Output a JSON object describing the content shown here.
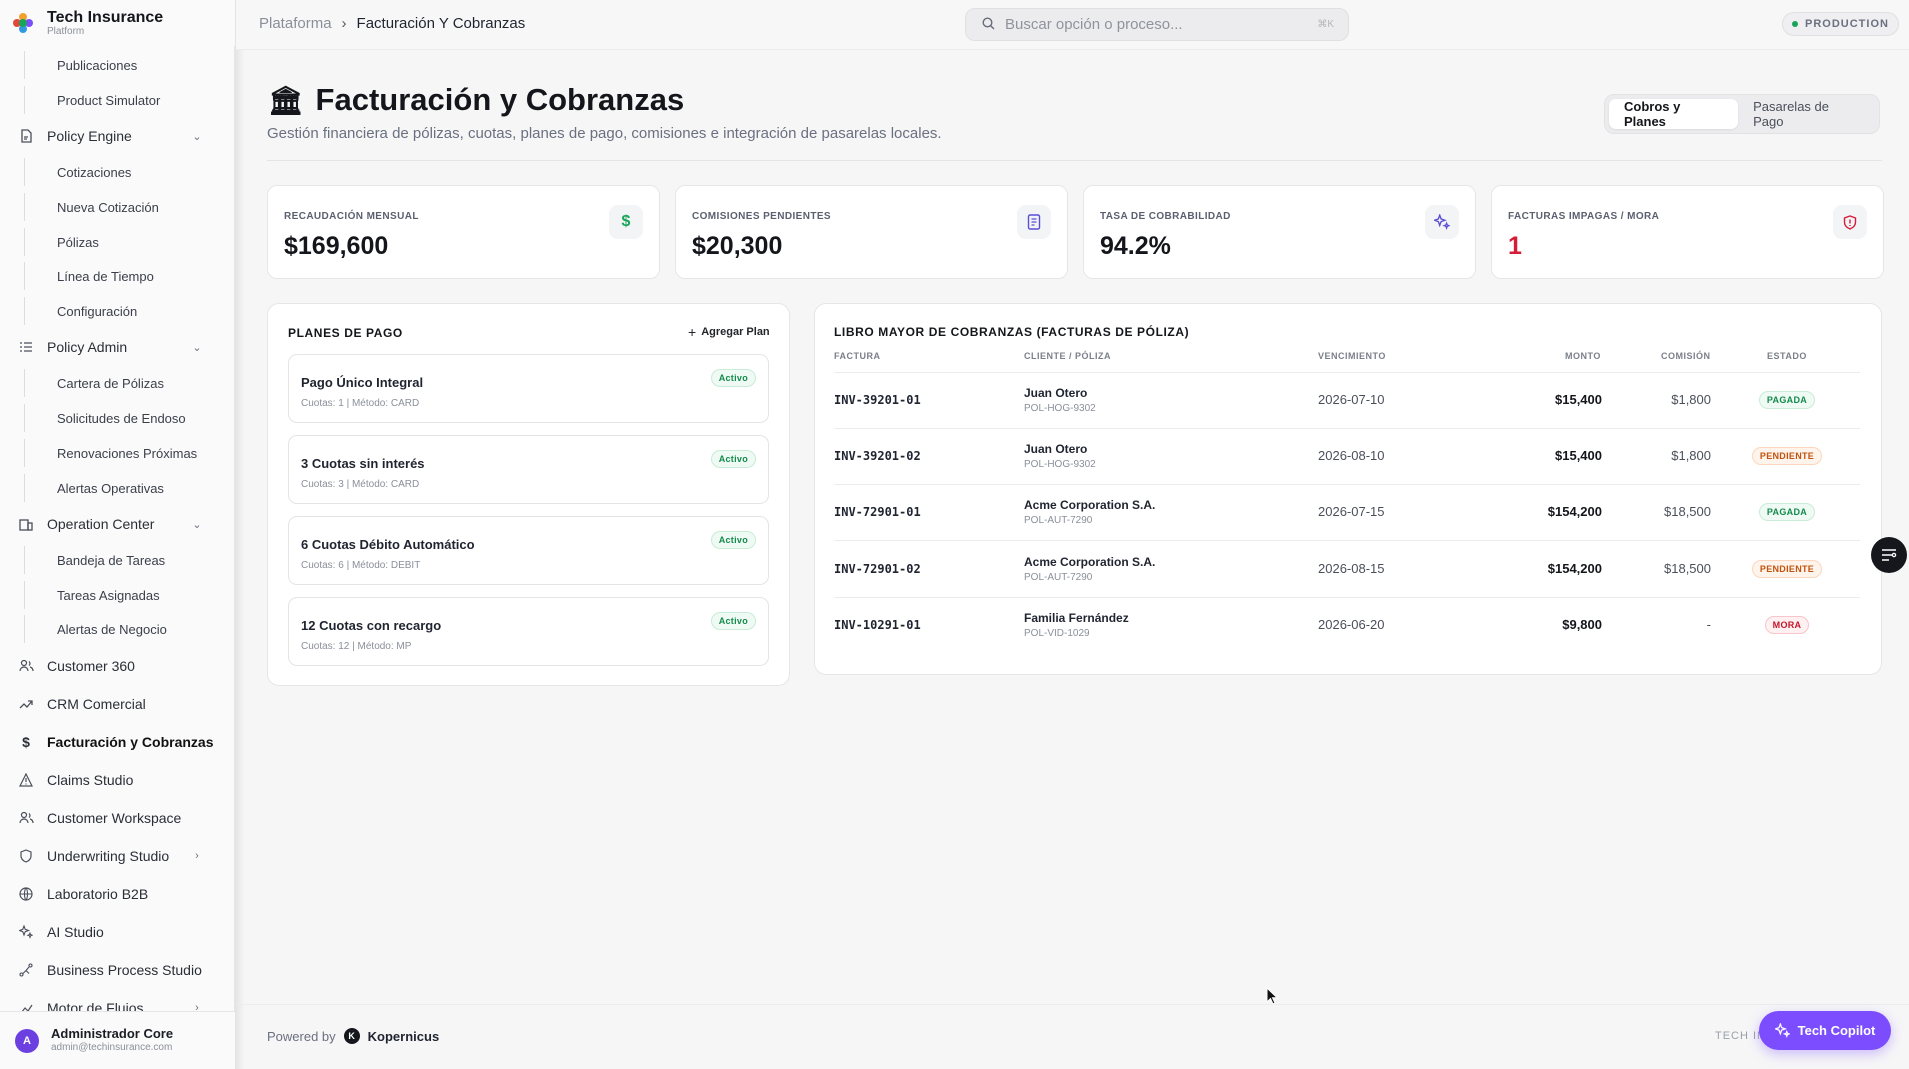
{
  "brand": {
    "name": "Tech Insurance",
    "sub": "Platform"
  },
  "sidebar": {
    "items": [
      {
        "label": "Publicaciones",
        "type": "sub"
      },
      {
        "label": "Product Simulator",
        "type": "sub"
      },
      {
        "label": "Policy Engine",
        "type": "group",
        "icon": "document-icon"
      },
      {
        "label": "Cotizaciones",
        "type": "sub"
      },
      {
        "label": "Nueva Cotización",
        "type": "sub"
      },
      {
        "label": "Pólizas",
        "type": "sub"
      },
      {
        "label": "Línea de Tiempo",
        "type": "sub"
      },
      {
        "label": "Configuración",
        "type": "sub"
      },
      {
        "label": "Policy Admin",
        "type": "group",
        "icon": "list-icon"
      },
      {
        "label": "Cartera de Pólizas",
        "type": "sub"
      },
      {
        "label": "Solicitudes de Endoso",
        "type": "sub"
      },
      {
        "label": "Renovaciones Próximas",
        "type": "sub"
      },
      {
        "label": "Alertas Operativas",
        "type": "sub"
      },
      {
        "label": "Operation Center",
        "type": "group",
        "icon": "building-icon"
      },
      {
        "label": "Bandeja de Tareas",
        "type": "sub"
      },
      {
        "label": "Tareas Asignadas",
        "type": "sub"
      },
      {
        "label": "Alertas de Negocio",
        "type": "sub"
      },
      {
        "label": "Customer 360",
        "type": "item",
        "icon": "users-icon"
      },
      {
        "label": "CRM Comercial",
        "type": "item",
        "icon": "trend-icon"
      },
      {
        "label": "Facturación y Cobranzas",
        "type": "item",
        "icon": "dollar-icon",
        "active": true
      },
      {
        "label": "Claims Studio",
        "type": "item",
        "icon": "warning-icon"
      },
      {
        "label": "Customer Workspace",
        "type": "item",
        "icon": "users-icon"
      },
      {
        "label": "Underwriting Studio",
        "type": "item",
        "icon": "shield-icon",
        "chevron": true
      },
      {
        "label": "Laboratorio B2B",
        "type": "item",
        "icon": "globe-icon"
      },
      {
        "label": "AI Studio",
        "type": "item",
        "icon": "sparkle-icon"
      },
      {
        "label": "Business Process Studio",
        "type": "item",
        "icon": "flow-icon"
      },
      {
        "label": "Motor de Flujos",
        "type": "item",
        "icon": "flow-icon",
        "chevron": true
      }
    ]
  },
  "user": {
    "initial": "A",
    "name": "Administrador Core",
    "email": "admin@techinsurance.com"
  },
  "topbar": {
    "breadcrumb_root": "Plataforma",
    "breadcrumb_current": "Facturación Y Cobranzas",
    "search_placeholder": "Buscar opción o proceso...",
    "shortcut": "⌘K",
    "env": "PRODUCTION"
  },
  "header": {
    "title": "Facturación y Cobranzas",
    "subtitle": "Gestión financiera de pólizas, cuotas, planes de pago, comisiones e integración de pasarelas locales.",
    "tabs": [
      "Cobros y Planes",
      "Pasarelas de Pago"
    ]
  },
  "kpis": [
    {
      "label": "RECAUDACIÓN MENSUAL",
      "value": "$169,600",
      "icon": "dollar-icon",
      "icon_color": "#18a558"
    },
    {
      "label": "COMISIONES PENDIENTES",
      "value": "$20,300",
      "icon": "receipt-icon",
      "icon_color": "#5b4fd6"
    },
    {
      "label": "TASA DE COBRABILIDAD",
      "value": "94.2%",
      "icon": "sparkle-icon",
      "icon_color": "#5b4fd6"
    },
    {
      "label": "FACTURAS IMPAGAS / MORA",
      "value": "1",
      "icon": "shield-alert-icon",
      "icon_color": "#d41d3a",
      "value_color": "#d41d3a"
    }
  ],
  "plans": {
    "title": "PLANES DE PAGO",
    "add_label": "Agregar Plan",
    "items": [
      {
        "name": "Pago Único Integral",
        "meta": "Cuotas: 1 | Método: CARD",
        "status": "Activo"
      },
      {
        "name": "3 Cuotas sin interés",
        "meta": "Cuotas: 3 | Método: CARD",
        "status": "Activo"
      },
      {
        "name": "6 Cuotas Débito Automático",
        "meta": "Cuotas: 6 | Método: DEBIT",
        "status": "Activo"
      },
      {
        "name": "12 Cuotas con recargo",
        "meta": "Cuotas: 12 | Método: MP",
        "status": "Activo"
      }
    ]
  },
  "ledger": {
    "title": "LIBRO MAYOR DE COBRANZAS (FACTURAS DE PÓLIZA)",
    "columns": [
      "FACTURA",
      "CLIENTE / PÓLIZA",
      "VENCIMIENTO",
      "MONTO",
      "COMISIÓN",
      "ESTADO"
    ],
    "rows": [
      {
        "invoice": "INV-39201-01",
        "client": "Juan Otero",
        "policy": "POL-HOG-9302",
        "due": "2026-07-10",
        "amount": "$15,400",
        "commission": "$1,800",
        "status": "PAGADA",
        "tone": "green"
      },
      {
        "invoice": "INV-39201-02",
        "client": "Juan Otero",
        "policy": "POL-HOG-9302",
        "due": "2026-08-10",
        "amount": "$15,400",
        "commission": "$1,800",
        "status": "PENDIENTE",
        "tone": "orange"
      },
      {
        "invoice": "INV-72901-01",
        "client": "Acme Corporation S.A.",
        "policy": "POL-AUT-7290",
        "due": "2026-07-15",
        "amount": "$154,200",
        "commission": "$18,500",
        "status": "PAGADA",
        "tone": "green"
      },
      {
        "invoice": "INV-72901-02",
        "client": "Acme Corporation S.A.",
        "policy": "POL-AUT-7290",
        "due": "2026-08-15",
        "amount": "$154,200",
        "commission": "$18,500",
        "status": "PENDIENTE",
        "tone": "orange"
      },
      {
        "invoice": "INV-10291-01",
        "client": "Familia Fernández",
        "policy": "POL-VID-1029",
        "due": "2026-06-20",
        "amount": "$9,800",
        "commission": "-",
        "status": "MORA",
        "tone": "red"
      }
    ]
  },
  "footer": {
    "powered_by": "Powered by",
    "k": "K",
    "company": "Kopernicus",
    "right": "TECH IN",
    "copilot": "Tech Copilot"
  }
}
